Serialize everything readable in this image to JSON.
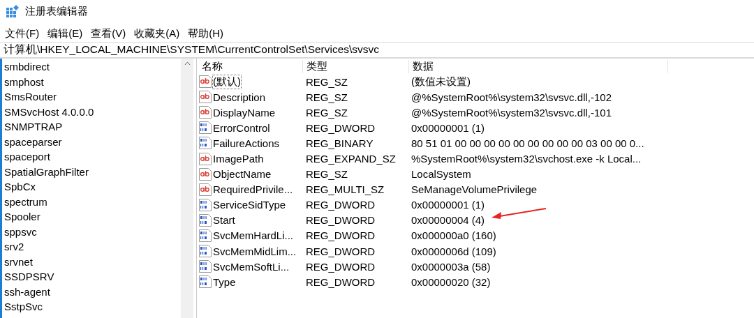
{
  "window": {
    "title": "注册表编辑器"
  },
  "menu": [
    {
      "label": "文件(F)"
    },
    {
      "label": "编辑(E)"
    },
    {
      "label": "查看(V)"
    },
    {
      "label": "收藏夹(A)"
    },
    {
      "label": "帮助(H)"
    }
  ],
  "address": "计算机\\HKEY_LOCAL_MACHINE\\SYSTEM\\CurrentControlSet\\Services\\svsvc",
  "tree": {
    "items": [
      {
        "label": "smbdirect"
      },
      {
        "label": "smphost"
      },
      {
        "label": "SmsRouter"
      },
      {
        "label": "SMSvcHost 4.0.0.0"
      },
      {
        "label": "SNMPTRAP"
      },
      {
        "label": "spaceparser"
      },
      {
        "label": "spaceport"
      },
      {
        "label": "SpatialGraphFilter"
      },
      {
        "label": "SpbCx"
      },
      {
        "label": "spectrum"
      },
      {
        "label": "Spooler"
      },
      {
        "label": "sppsvc"
      },
      {
        "label": "srv2"
      },
      {
        "label": "srvnet"
      },
      {
        "label": "SSDPSRV"
      },
      {
        "label": "ssh-agent"
      },
      {
        "label": "SstpSvc"
      }
    ]
  },
  "table": {
    "columns": [
      "名称",
      "类型",
      "数据"
    ],
    "rows": [
      {
        "kind": "string",
        "name": "(默认)",
        "type": "REG_SZ",
        "data": "(数值未设置)",
        "focused": true,
        "marked": false
      },
      {
        "kind": "string",
        "name": "Description",
        "type": "REG_SZ",
        "data": "@%SystemRoot%\\system32\\svsvc.dll,-102",
        "focused": false,
        "marked": false
      },
      {
        "kind": "string",
        "name": "DisplayName",
        "type": "REG_SZ",
        "data": "@%SystemRoot%\\system32\\svsvc.dll,-101",
        "focused": false,
        "marked": false
      },
      {
        "kind": "binary",
        "name": "ErrorControl",
        "type": "REG_DWORD",
        "data": "0x00000001 (1)",
        "focused": false,
        "marked": false
      },
      {
        "kind": "binary",
        "name": "FailureActions",
        "type": "REG_BINARY",
        "data": "80 51 01 00 00 00 00 00 00 00 00 00 03 00 00 0...",
        "focused": false,
        "marked": false
      },
      {
        "kind": "string",
        "name": "ImagePath",
        "type": "REG_EXPAND_SZ",
        "data": "%SystemRoot%\\system32\\svchost.exe -k Local...",
        "focused": false,
        "marked": false
      },
      {
        "kind": "string",
        "name": "ObjectName",
        "type": "REG_SZ",
        "data": "LocalSystem",
        "focused": false,
        "marked": false
      },
      {
        "kind": "string",
        "name": "RequiredPrivile...",
        "type": "REG_MULTI_SZ",
        "data": "SeManageVolumePrivilege",
        "focused": false,
        "marked": false
      },
      {
        "kind": "binary",
        "name": "ServiceSidType",
        "type": "REG_DWORD",
        "data": "0x00000001 (1)",
        "focused": false,
        "marked": false
      },
      {
        "kind": "binary",
        "name": "Start",
        "type": "REG_DWORD",
        "data": "0x00000004 (4)",
        "focused": false,
        "marked": true
      },
      {
        "kind": "binary",
        "name": "SvcMemHardLi...",
        "type": "REG_DWORD",
        "data": "0x000000a0 (160)",
        "focused": false,
        "marked": false
      },
      {
        "kind": "binary",
        "name": "SvcMemMidLim...",
        "type": "REG_DWORD",
        "data": "0x0000006d (109)",
        "focused": false,
        "marked": false
      },
      {
        "kind": "binary",
        "name": "SvcMemSoftLi...",
        "type": "REG_DWORD",
        "data": "0x0000003a (58)",
        "focused": false,
        "marked": false
      },
      {
        "kind": "binary",
        "name": "Type",
        "type": "REG_DWORD",
        "data": "0x00000020 (32)",
        "focused": false,
        "marked": false
      }
    ]
  }
}
